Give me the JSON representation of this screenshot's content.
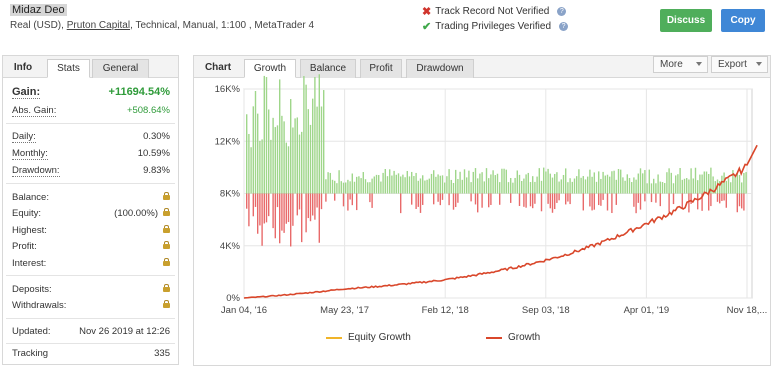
{
  "header": {
    "account_name": "Midaz Deo",
    "desc_prefix": "Real (USD), ",
    "broker": "Pruton Capital",
    "desc_suffix": ", Technical, Manual, 1:100 , MetaTrader 4",
    "track_record": "Track Record Not Verified",
    "trading_privileges": "Trading Privileges Verified",
    "discuss_label": "Discuss",
    "copy_label": "Copy"
  },
  "left_tabs": {
    "info": "Info",
    "stats": "Stats",
    "general": "General"
  },
  "stats": {
    "gain_label": "Gain:",
    "gain_value": "+11694.54%",
    "abs_gain_label": "Abs. Gain:",
    "abs_gain_value": "+508.64%",
    "daily_label": "Daily:",
    "daily_value": "0.30%",
    "monthly_label": "Monthly:",
    "monthly_value": "10.59%",
    "drawdown_label": "Drawdown:",
    "drawdown_value": "9.83%",
    "balance_label": "Balance:",
    "equity_label": "Equity:",
    "equity_value": "(100.00%)",
    "highest_label": "Highest:",
    "profit_label": "Profit:",
    "interest_label": "Interest:",
    "deposits_label": "Deposits:",
    "withdrawals_label": "Withdrawals:",
    "updated_label": "Updated:",
    "updated_value": "Nov 26 2019 at 12:26",
    "tracking_label": "Tracking",
    "tracking_value": "335"
  },
  "chart_tabs": {
    "chart": "Chart",
    "growth": "Growth",
    "balance": "Balance",
    "profit": "Profit",
    "drawdown": "Drawdown",
    "more": "More",
    "export": "Export"
  },
  "colors": {
    "growth_line": "#d9472b",
    "equity_line": "#f0b429",
    "bar_pos": "#9fd68a",
    "bar_neg": "#e86a6a",
    "grid": "#e6e6e6"
  },
  "chart_data": {
    "type": "line",
    "x_tick_labels": [
      "Jan 04, '16",
      "May 23, '17",
      "Feb 12, '18",
      "Sep 03, '18",
      "Apr 01, '19",
      "Nov 18,..."
    ],
    "y_tick_labels": [
      "16K%",
      "12K%",
      "8K%",
      "4K%",
      "0%"
    ],
    "ylim": [
      0,
      16000
    ],
    "series": [
      {
        "name": "Equity Growth",
        "values": []
      },
      {
        "name": "Growth",
        "x": [
          "Jan 04, '16",
          "May 23, '17",
          "Feb 12, '18",
          "Sep 03, '18",
          "Apr 01, '19",
          "Nov 18,..."
        ],
        "values": [
          0,
          700,
          1400,
          2900,
          5700,
          10100
        ]
      }
    ],
    "endpoint_value": 11700,
    "bars_baseline": 8000,
    "legend_position": "bottom"
  }
}
